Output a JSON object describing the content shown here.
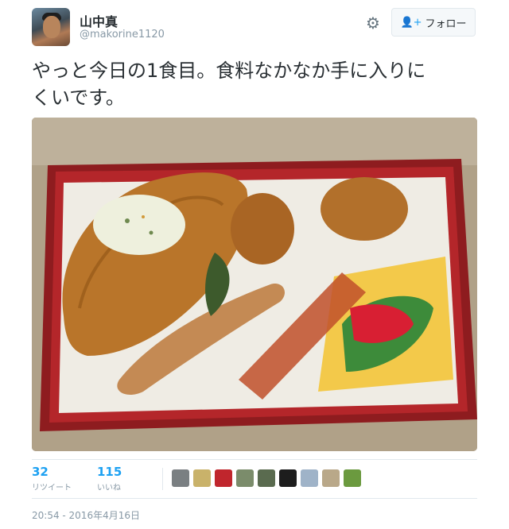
{
  "user": {
    "name": "山中真",
    "handle": "@makorine1120"
  },
  "actions": {
    "follow_label": "フォロー"
  },
  "tweet": {
    "text_line1": "やっと今日の1食目。食料なかなか手に入りに",
    "text_line2": "くいです。",
    "photo_description": "bento-box-photo"
  },
  "stats": {
    "retweets_count": "32",
    "retweets_label": "リツイート",
    "likes_count": "115",
    "likes_label": "いいね"
  },
  "likers": [
    {
      "color": "#7a7f82"
    },
    {
      "color": "#c9b26a"
    },
    {
      "color": "#c0262d"
    },
    {
      "color": "#7b8c6b"
    },
    {
      "color": "#5a6b4f"
    },
    {
      "color": "#1d1d1d"
    },
    {
      "color": "#9fb3c8"
    },
    {
      "color": "#b9a889"
    },
    {
      "color": "#6b9a3f"
    }
  ],
  "timestamp": "20:54 - 2016年4月16日",
  "colors": {
    "accent": "#1da1f2",
    "muted": "#8899a6",
    "text": "#292f33"
  }
}
